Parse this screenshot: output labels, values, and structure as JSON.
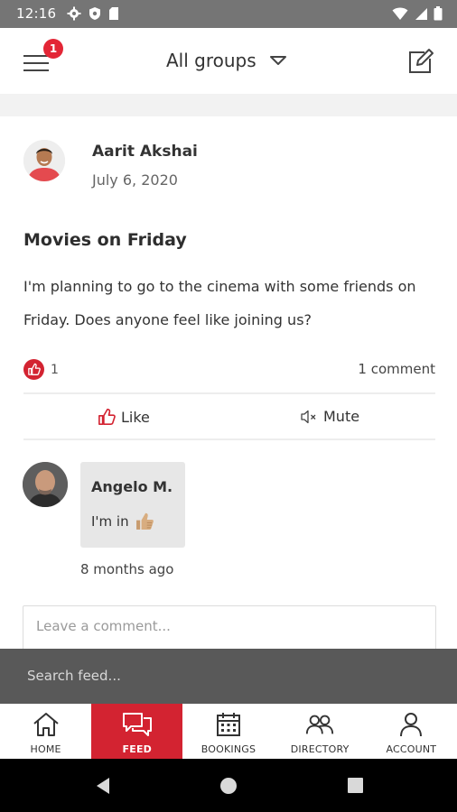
{
  "status_bar": {
    "time": "12:16",
    "left_icons": [
      "gear-icon",
      "shield-icon",
      "sd-card-icon"
    ],
    "right_icons": [
      "wifi-icon",
      "signal-icon",
      "battery-icon"
    ]
  },
  "header": {
    "group_title": "All groups",
    "notification_count": "1",
    "icons": [
      "hamburger-menu-icon",
      "caret-down-icon",
      "compose-icon"
    ]
  },
  "post": {
    "author": "Aarit Akshai",
    "date": "July 6, 2020",
    "title": "Movies on Friday",
    "body": "I'm planning to go to the cinema with some friends on Friday. Does anyone feel like joining us?",
    "like_count": "1",
    "comment_count": "1 comment",
    "actions": {
      "like_label": "Like",
      "mute_label": "Mute"
    }
  },
  "comment": {
    "author": "Angelo M.",
    "text": "I'm in",
    "emoji": "thumbs-up-emoji",
    "time": "8 months ago"
  },
  "comment_input": {
    "placeholder": "Leave a comment..."
  },
  "search": {
    "placeholder": "Search feed..."
  },
  "tabs": [
    {
      "label": "HOME",
      "icon": "home-icon",
      "active": false
    },
    {
      "label": "FEED",
      "icon": "chat-icon",
      "active": true
    },
    {
      "label": "BOOKINGS",
      "icon": "calendar-icon",
      "active": false
    },
    {
      "label": "DIRECTORY",
      "icon": "people-icon",
      "active": false
    },
    {
      "label": "ACCOUNT",
      "icon": "user-icon",
      "active": false
    }
  ],
  "colors": {
    "accent": "#d32331",
    "status_bar": "#757575",
    "search_bar": "#595959",
    "comment_bubble": "#e7e7e7"
  }
}
